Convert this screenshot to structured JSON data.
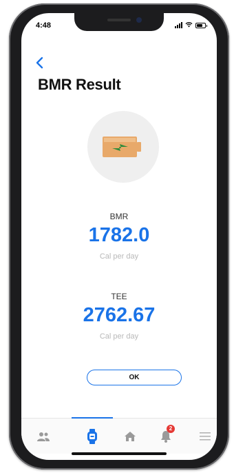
{
  "status_bar": {
    "time": "4:48"
  },
  "header": {
    "title": "BMR Result"
  },
  "result_icon": {
    "name": "battery-charging-icon",
    "battery_color": "#e8a96a",
    "bolt_color": "#2e8b3a"
  },
  "bmr": {
    "label": "BMR",
    "value": "1782.0",
    "unit": "Cal per day"
  },
  "tee": {
    "label": "TEE",
    "value": "2762.67",
    "unit": "Cal per day"
  },
  "actions": {
    "ok_label": "OK"
  },
  "tab_bar": {
    "active_index": 1,
    "items": [
      {
        "icon": "users-icon"
      },
      {
        "icon": "watch-icon"
      },
      {
        "icon": "home-icon"
      },
      {
        "icon": "bell-icon",
        "badge": "2"
      },
      {
        "icon": "menu-icon"
      }
    ]
  },
  "colors": {
    "accent": "#1a73e8",
    "badge": "#e53935",
    "unit_text": "#b8b8b8"
  }
}
